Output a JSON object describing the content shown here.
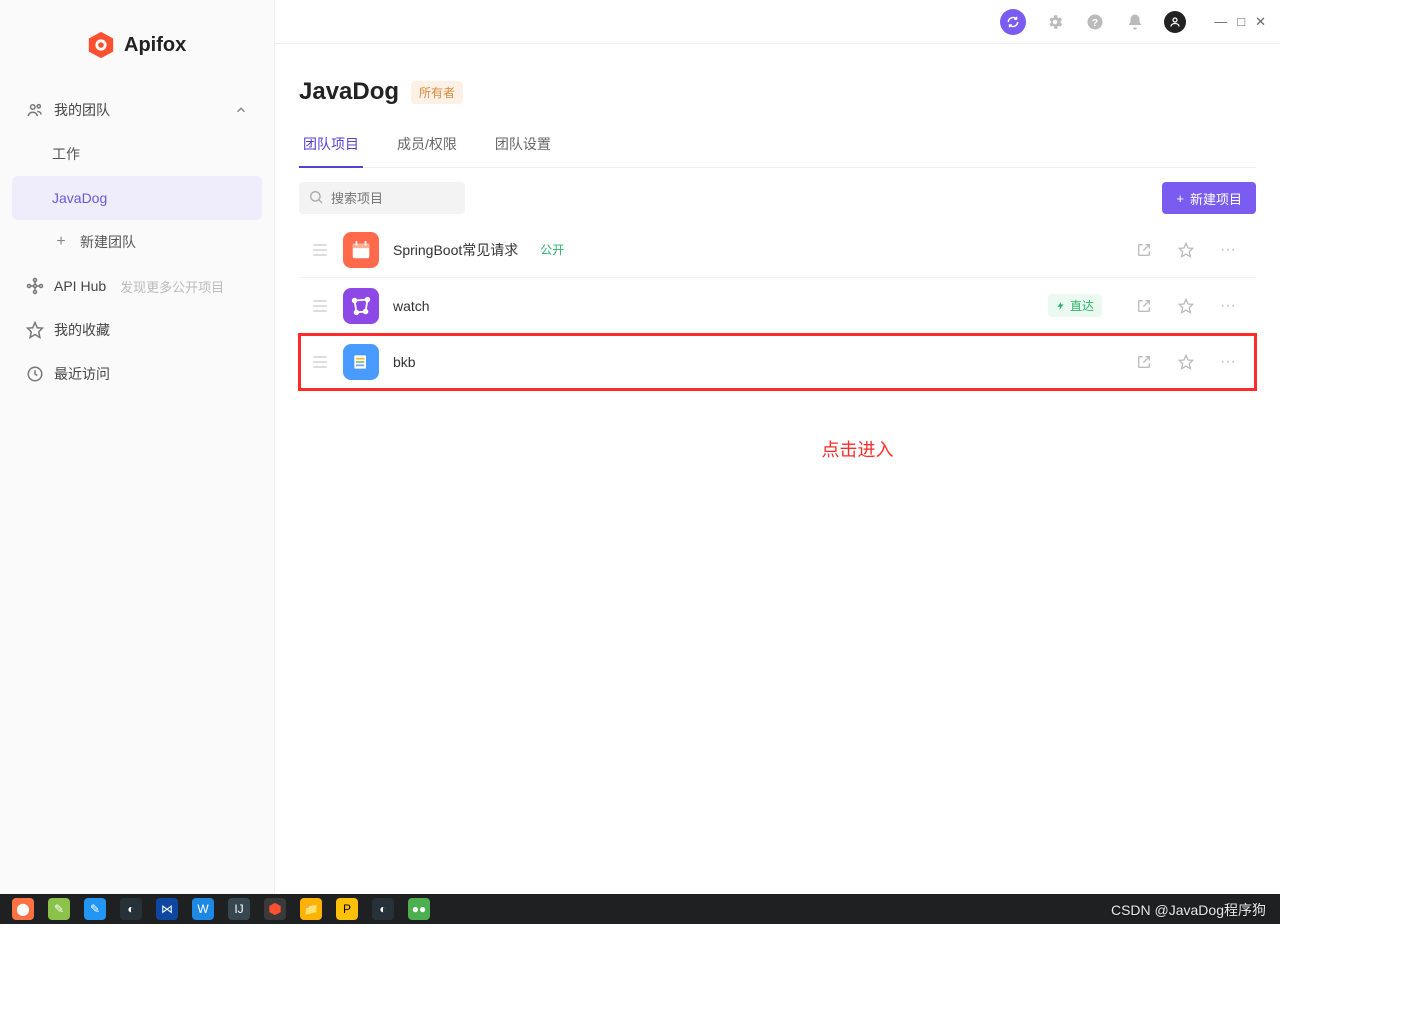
{
  "app_name": "Apifox",
  "sidebar": {
    "my_team_label": "我的团队",
    "items": [
      "工作",
      "JavaDog"
    ],
    "new_team_label": "新建团队",
    "api_hub_label": "API Hub",
    "api_hub_hint": "发现更多公开项目",
    "favorites_label": "我的收藏",
    "recent_label": "最近访问"
  },
  "team": {
    "title": "JavaDog",
    "owner_badge": "所有者"
  },
  "tabs": [
    "团队项目",
    "成员/权限",
    "团队设置"
  ],
  "search_placeholder": "搜索项目",
  "new_project_label": "新建项目",
  "projects": [
    {
      "name": "SpringBoot常见请求",
      "badge": "公开",
      "icon": "calendar",
      "color": "pi-red",
      "zhida": false
    },
    {
      "name": "watch",
      "badge": "",
      "icon": "polygon",
      "color": "pi-purple",
      "zhida": true
    },
    {
      "name": "bkb",
      "badge": "",
      "icon": "books",
      "color": "pi-blue",
      "zhida": false
    }
  ],
  "zhida_label": "直达",
  "annotation_text": "点击进入",
  "watermark": "CSDN @JavaDog程序狗"
}
